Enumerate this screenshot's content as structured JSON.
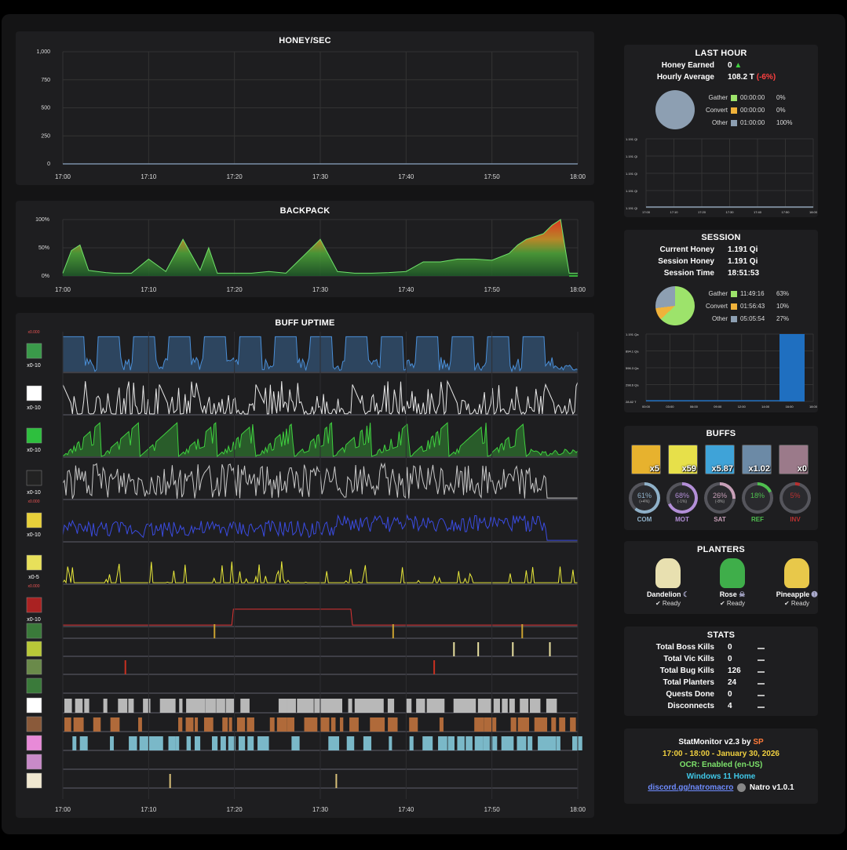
{
  "honey_sec": {
    "title": "HONEY/SEC",
    "y_ticks": [
      "1,000",
      "750",
      "500",
      "250",
      "0"
    ],
    "x_ticks": [
      "17:00",
      "17:10",
      "17:20",
      "17:30",
      "17:40",
      "17:50",
      "18:00"
    ],
    "chart_data": {
      "type": "line",
      "x": [
        "17:00",
        "17:10",
        "17:20",
        "17:30",
        "17:40",
        "17:50",
        "18:00"
      ],
      "values": [
        0,
        0,
        0,
        0,
        0,
        0,
        0
      ],
      "ylim": [
        0,
        1000
      ],
      "title": "HONEY/SEC"
    }
  },
  "backpack": {
    "title": "BACKPACK",
    "y_ticks": [
      "100%",
      "50%",
      "0%"
    ],
    "x_ticks": [
      "17:00",
      "17:10",
      "17:20",
      "17:30",
      "17:40",
      "17:50",
      "18:00"
    ],
    "chart_data": {
      "type": "area",
      "x_minutes": [
        0,
        1,
        2,
        3,
        4,
        5,
        6,
        8,
        10,
        12,
        14,
        16,
        17,
        18,
        19,
        20,
        22,
        24,
        26,
        28,
        30,
        32,
        34,
        36,
        38,
        40,
        42,
        44,
        46,
        48,
        50,
        52,
        53,
        54,
        55,
        56,
        57,
        58,
        59,
        60
      ],
      "values": [
        5,
        45,
        55,
        10,
        8,
        6,
        5,
        5,
        30,
        8,
        65,
        10,
        50,
        5,
        5,
        5,
        5,
        8,
        5,
        35,
        65,
        8,
        5,
        5,
        6,
        8,
        25,
        25,
        30,
        30,
        28,
        40,
        55,
        65,
        70,
        75,
        90,
        100,
        5,
        5
      ],
      "ylim": [
        0,
        100
      ],
      "title": "BACKPACK"
    }
  },
  "buff_uptime": {
    "title": "BUFF UPTIME",
    "x_ticks": [
      "17:00",
      "17:10",
      "17:20",
      "17:30",
      "17:40",
      "17:50",
      "18:00"
    ],
    "rows": [
      {
        "name": "combo",
        "color": "#4a8fd8",
        "scale": "x0-10",
        "top": "x0.000"
      },
      {
        "name": "haste",
        "color": "#e8e8e8",
        "scale": "x0-10"
      },
      {
        "name": "focus",
        "color": "#3fd13f",
        "scale": "x0-10"
      },
      {
        "name": "melody",
        "color": "#c8c8c8",
        "scale": "x0-10"
      },
      {
        "name": "boost",
        "color": "#3a4be0",
        "scale": "x0-10",
        "top": "x0.000"
      },
      {
        "name": "bomb",
        "color": "#e8e83a",
        "scale": "x0-5"
      },
      {
        "name": "baby-love",
        "color": "#d33",
        "scale": "x0-10",
        "top": "x0.000"
      }
    ]
  },
  "last_hour": {
    "title": "LAST HOUR",
    "honey_earned_label": "Honey Earned",
    "honey_earned_value": "0",
    "hourly_avg_label": "Hourly Average",
    "hourly_avg_value": "108.2 T",
    "hourly_avg_change": "(-6%)",
    "legend": [
      {
        "label": "Gather",
        "time": "00:00:00",
        "pct": "0%",
        "color": "#9de36b"
      },
      {
        "label": "Convert",
        "time": "00:00:00",
        "pct": "0%",
        "color": "#f0b23a"
      },
      {
        "label": "Other",
        "time": "01:00:00",
        "pct": "100%",
        "color": "#8d9fb2"
      }
    ],
    "y_ticks": [
      "1.191 Qi",
      "1.191 Qi",
      "1.191 Qi",
      "1.191 Qi",
      "1.191 Qi"
    ],
    "x_ticks": [
      "17:00",
      "17:10",
      "17:20",
      "17:30",
      "17:40",
      "17:50",
      "18:00"
    ]
  },
  "session": {
    "title": "SESSION",
    "current_honey_label": "Current Honey",
    "current_honey_value": "1.191 Qi",
    "session_honey_label": "Session Honey",
    "session_honey_value": "1.191 Qi",
    "session_time_label": "Session Time",
    "session_time_value": "18:51:53",
    "legend": [
      {
        "label": "Gather",
        "time": "11:49:16",
        "pct": "63%",
        "color": "#9de36b"
      },
      {
        "label": "Convert",
        "time": "01:56:43",
        "pct": "10%",
        "color": "#f0b23a"
      },
      {
        "label": "Other",
        "time": "05:05:54",
        "pct": "27%",
        "color": "#8d9fb2"
      }
    ],
    "y_ticks": [
      "1.191 Qa",
      "894.1 Qa",
      "596.3 Qa",
      "298.6 Qa",
      "28.82 T"
    ],
    "x_ticks": [
      "00:00",
      "03:00",
      "06:00",
      "09:00",
      "12:00",
      "14:00",
      "16:00",
      "18:00"
    ]
  },
  "buffs": {
    "title": "BUFFS",
    "items": [
      {
        "name": "clock-icon",
        "count": "x5",
        "bg": "#e7b22e"
      },
      {
        "name": "blue-boost-icon",
        "count": "x59",
        "bg": "#e7e04a"
      },
      {
        "name": "bubble-icon",
        "count": "x5.87",
        "bg": "#3fa3d8"
      },
      {
        "name": "tide-icon",
        "count": "x1.02",
        "bg": "#6c8aa6"
      },
      {
        "name": "chick-icon",
        "count": "x0",
        "bg": "#9b7a8a"
      }
    ],
    "rings": [
      {
        "abbr": "COM",
        "pct": "61%",
        "sub": "(+4%)",
        "color": "#8fb0c8",
        "value": 0.61
      },
      {
        "abbr": "MOT",
        "pct": "68%",
        "sub": "(-1%)",
        "color": "#b38fd8",
        "value": 0.68
      },
      {
        "abbr": "SAT",
        "pct": "26%",
        "sub": "(-8%)",
        "color": "#c8a0b8",
        "value": 0.26
      },
      {
        "abbr": "REF",
        "pct": "18%",
        "sub": "",
        "color": "#4fbf4f",
        "value": 0.18
      },
      {
        "abbr": "INV",
        "pct": "5%",
        "sub": "",
        "color": "#b83030",
        "value": 0.05
      }
    ]
  },
  "planters": {
    "title": "PLANTERS",
    "items": [
      {
        "name": "Dandelion",
        "status": "Ready",
        "symbol": "☾"
      },
      {
        "name": "Rose",
        "status": "Ready",
        "symbol": "☠"
      },
      {
        "name": "Pineapple",
        "status": "Ready",
        "symbol": "➊"
      }
    ]
  },
  "stats": {
    "title": "STATS",
    "rows": [
      {
        "label": "Total Boss Kills",
        "value": "0"
      },
      {
        "label": "Total Vic Kills",
        "value": "0"
      },
      {
        "label": "Total Bug Kills",
        "value": "126"
      },
      {
        "label": "Total Planters",
        "value": "24"
      },
      {
        "label": "Quests Done",
        "value": "0"
      },
      {
        "label": "Disconnects",
        "value": "4"
      }
    ]
  },
  "footer": {
    "version_text": "StatMonitor v2.3 by",
    "author": "SP",
    "time_range": "17:00 - 18:00 - January 30, 2026",
    "ocr": "OCR: Enabled (en-US)",
    "os": "Windows 11 Home",
    "link": "discord.gg/natromacro",
    "natro": "Natro v1.0.1"
  }
}
